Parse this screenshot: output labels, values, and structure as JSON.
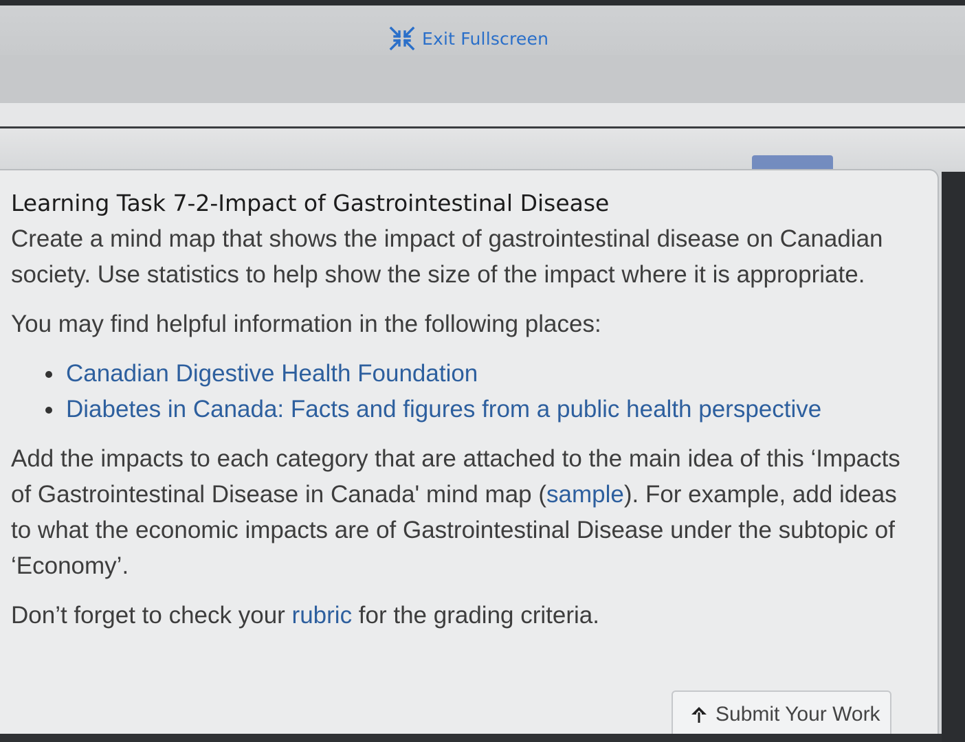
{
  "fullscreen_bar": {
    "exit_label": "Exit Fullscreen",
    "icon": "exit-fullscreen-icon"
  },
  "task": {
    "title": "Learning Task 7-2-Impact of Gastrointestinal Disease",
    "intro": "Create a mind map that shows the impact of gastrointestinal disease on Canadian society. Use statistics to help show the size of the impact where it is appropriate.",
    "find_info": "You may find helpful information in the following places:",
    "resources": [
      "Canadian Digestive Health Foundation",
      "Diabetes in Canada: Facts and figures from a public health perspective"
    ],
    "instructions_before_link": "Add the impacts to each category that are attached to the main idea of this ‘Impacts of Gastrointestinal Disease in Canada' mind map (",
    "sample_link": "sample",
    "instructions_after_link": "). For example, add ideas to what the economic impacts are of Gastrointestinal Disease under the subtopic of ‘Economy’.",
    "rubric_before": "Don’t forget to check your ",
    "rubric_link": "rubric",
    "rubric_after": " for the grading criteria."
  },
  "submit": {
    "label": "Submit Your Work",
    "icon": "upload-arrow-icon"
  },
  "colors": {
    "link": "#2d5f9e",
    "exit_fullscreen": "#2a6fc9",
    "panel_background": "#ebeced"
  }
}
